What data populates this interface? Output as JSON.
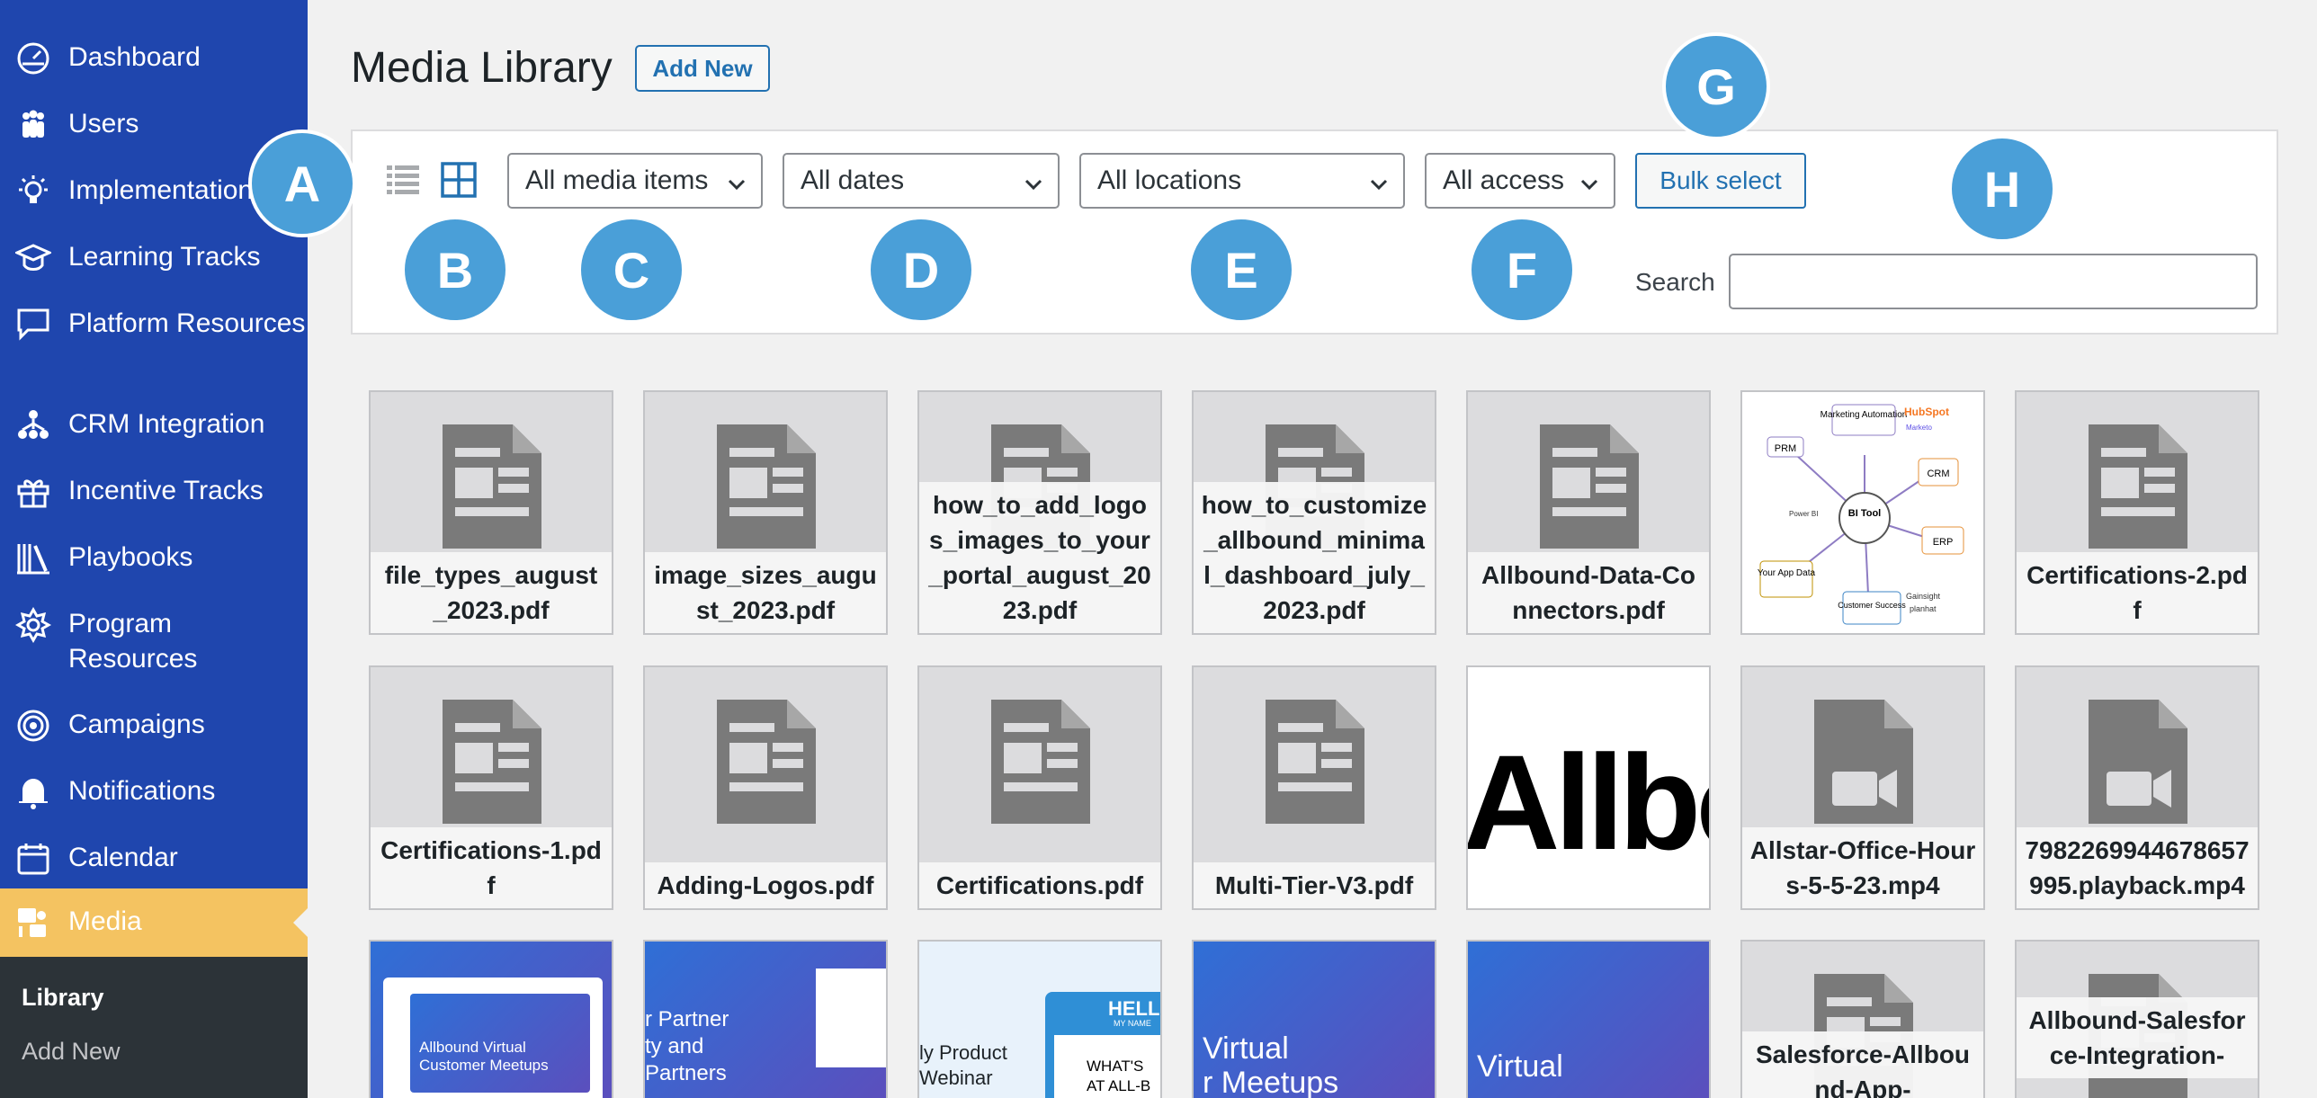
{
  "sidebar": {
    "items": [
      {
        "label": "Dashboard",
        "icon": "dashboard-icon"
      },
      {
        "label": "Users",
        "icon": "users-icon"
      },
      {
        "label": "Implementation",
        "icon": "lightbulb-icon"
      },
      {
        "label": "Learning Tracks",
        "icon": "graduation-cap-icon"
      },
      {
        "label": "Platform Resources",
        "icon": "speech-bubble-icon"
      },
      {
        "label": "CRM Integration",
        "icon": "network-icon"
      },
      {
        "label": "Incentive Tracks",
        "icon": "gift-icon"
      },
      {
        "label": "Playbooks",
        "icon": "books-icon"
      },
      {
        "label": "Program Resources",
        "icon": "settings-icon"
      },
      {
        "label": "Campaigns",
        "icon": "target-icon"
      },
      {
        "label": "Notifications",
        "icon": "bell-icon"
      },
      {
        "label": "Calendar",
        "icon": "calendar-icon"
      },
      {
        "label": "Media",
        "icon": "media-icon",
        "active": true
      }
    ],
    "submenu": {
      "library": "Library",
      "add_new": "Add New"
    }
  },
  "header": {
    "title": "Media Library",
    "add_new": "Add New"
  },
  "toolbar": {
    "media_filter": "All media items",
    "date_filter": "All dates",
    "location_filter": "All locations",
    "access_filter": "All access",
    "bulk_select": "Bulk select",
    "search_label": "Search",
    "search_value": ""
  },
  "callouts": [
    "A",
    "B",
    "C",
    "D",
    "E",
    "F",
    "G",
    "H"
  ],
  "media": {
    "row1": [
      "file_types_august_2023.pdf",
      "image_sizes_august_2023.pdf",
      "how_to_add_logos_images_to_your_portal_august_2023.pdf",
      "how_to_customize_allbound_minimal_dashboard_july_2023.pdf",
      "Allbound-Data-Connectors.pdf",
      "",
      "Certifications-2.pdf"
    ],
    "row2": [
      "Certifications-1.pdf",
      "Adding-Logos.pdf",
      "Certifications.pdf",
      "Multi-Tier-V3.pdf",
      "",
      "Allstar-Office-Hours-5-5-23.mp4",
      "7982269944678657995.playback.mp4"
    ],
    "row3": [
      "",
      "",
      "",
      "",
      "",
      "Salesforce-Allbound-App-",
      "Allbound-Salesforce-Integration-"
    ],
    "diagram_labels": {
      "center": "BI Tool",
      "prm": "PRM",
      "marketing": "Marketing Automation",
      "hubspot": "HubSpot",
      "marketo": "Marketo",
      "crm": "CRM",
      "erp": "ERP",
      "power_bi": "Power BI",
      "your_app": "Your App Data",
      "customer_success": "Customer Success",
      "gainsight": "Gainsight",
      "planhat": "planhat"
    },
    "logo_text": "Allbo",
    "thumb_texts": {
      "t1_title": "Allbound Virtual Customer Meetups",
      "t2": "r Partner\nty and\nPartners",
      "t3": "ly Product\nWebinar",
      "t3_hello": "HELL",
      "t3_name": "MY NAME",
      "t3_whats": "WHAT'S\nAT ALL-B",
      "t4": "Virtual\nr Meetups",
      "t5": "Virtual"
    }
  },
  "colors": {
    "sidebar": "#1f46ae",
    "active_menu": "#f4c361",
    "submenu": "#2c3338",
    "accent": "#2271b1",
    "callout": "#4a9fd8"
  }
}
